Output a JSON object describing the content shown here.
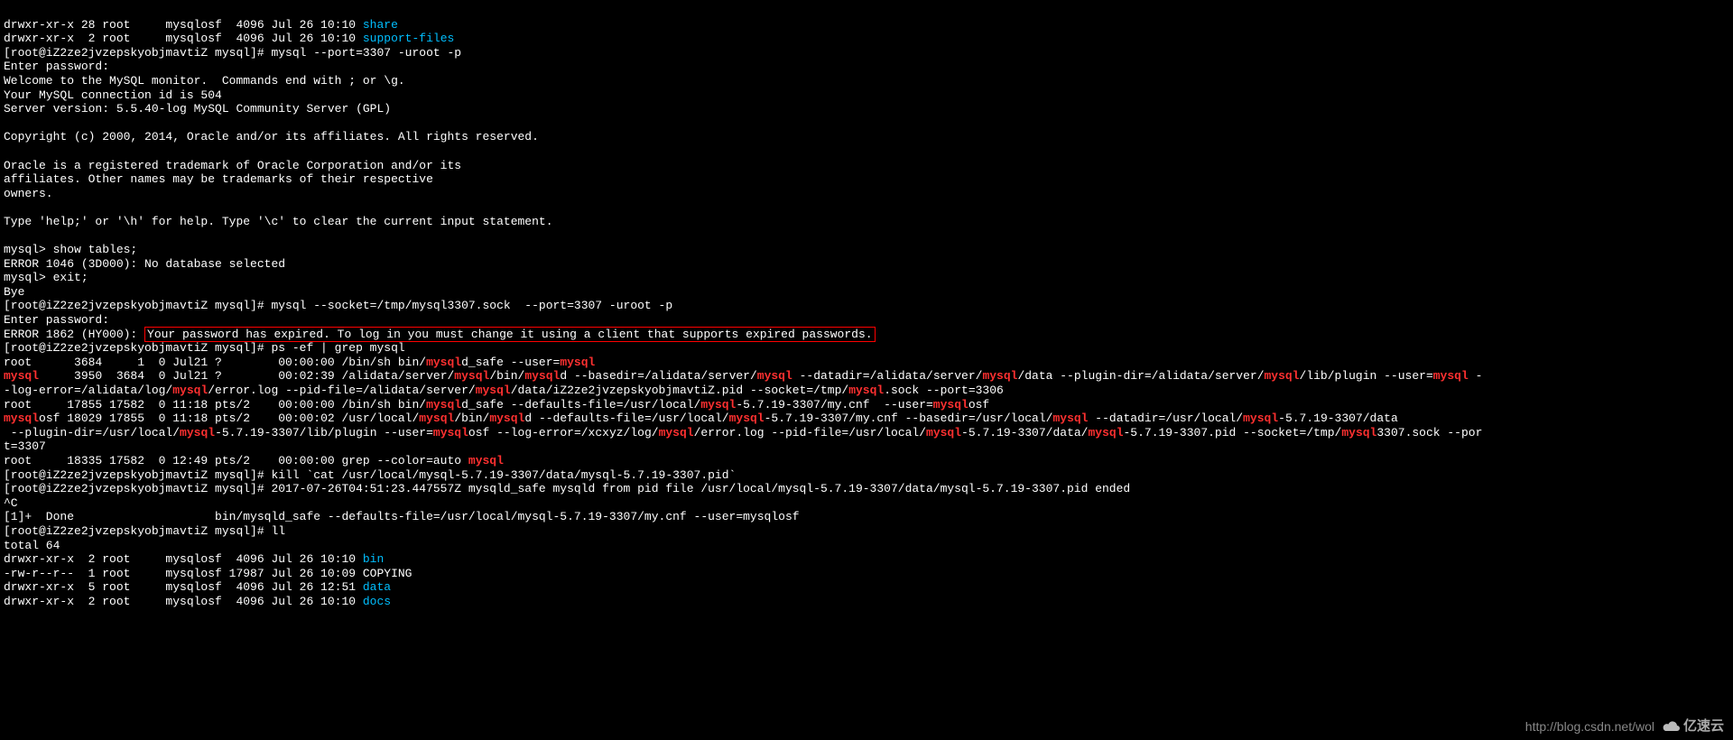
{
  "ls_top": {
    "l1a": "drwxr-xr-x 28 root     mysqlosf  4096 Jul 26 10:10 ",
    "l1b": "share",
    "l2a": "drwxr-xr-x  2 root     mysqlosf  4096 Jul 26 10:10 ",
    "l2b": "support-files"
  },
  "prompt1": "[root@iZ2ze2jvzepskyobjmavtiZ mysql]# mysql --port=3307 -uroot -p",
  "login": {
    "l1": "Enter password:",
    "l2": "Welcome to the MySQL monitor.  Commands end with ; or \\g.",
    "l3": "Your MySQL connection id is 504",
    "l4": "Server version: 5.5.40-log MySQL Community Server (GPL)",
    "blank1": "",
    "l5": "Copyright (c) 2000, 2014, Oracle and/or its affiliates. All rights reserved.",
    "blank2": "",
    "l6": "Oracle is a registered trademark of Oracle Corporation and/or its",
    "l7": "affiliates. Other names may be trademarks of their respective",
    "l8": "owners.",
    "blank3": "",
    "l9": "Type 'help;' or '\\h' for help. Type '\\c' to clear the current input statement.",
    "blank4": ""
  },
  "sql": {
    "l1": "mysql> show tables;",
    "l2": "ERROR 1046 (3D000): No database selected",
    "l3": "mysql> exit;",
    "l4": "Bye"
  },
  "prompt2": "[root@iZ2ze2jvzepskyobjmavtiZ mysql]# mysql --socket=/tmp/mysql3307.sock  --port=3307 -uroot -p",
  "enterpw": "Enter password:",
  "err": {
    "prefix": "ERROR 1862 (HY000): ",
    "msg": "Your password has expired. To log in you must change it using a client that supports expired passwords."
  },
  "prompt3": "[root@iZ2ze2jvzepskyobjmavtiZ mysql]# ps -ef | grep mysql",
  "ps": {
    "r1": {
      "a": "root      3684     1  0 Jul21 ?        00:00:00 /bin/sh bin/",
      "b": "mysql",
      "c": "d_safe --user=",
      "d": "mysql"
    },
    "r2": {
      "a": "mysql",
      "b": "     3950  3684  0 Jul21 ?        00:02:39 /alidata/server/",
      "c": "mysql",
      "d": "/bin/",
      "e": "mysql",
      "f": "d --basedir=/alidata/server/",
      "g": "mysql",
      "h": " --datadir=/alidata/server/",
      "i": "mysql",
      "j": "/data --plugin-dir=/alidata/server/",
      "k": "mysql",
      "l": "/lib/plugin --user=",
      "m": "mysql",
      "n": " -"
    },
    "r2b": {
      "a": "-log-error=/alidata/log/",
      "b": "mysql",
      "c": "/error.log --pid-file=/alidata/server/",
      "d": "mysql",
      "e": "/data/iZ2ze2jvzepskyobjmavtiZ.pid --socket=/tmp/",
      "f": "mysql",
      "g": ".sock --port=3306"
    },
    "r3": {
      "a": "root     17855 17582  0 11:18 pts/2    00:00:00 /bin/sh bin/",
      "b": "mysql",
      "c": "d_safe --defaults-file=/usr/local/",
      "d": "mysql",
      "e": "-5.7.19-3307/my.cnf  --user=",
      "f": "mysql",
      "g": "osf"
    },
    "r4": {
      "a": "mysql",
      "b": "osf 18029 17855  0 11:18 pts/2    00:00:02 /usr/local/",
      "c": "mysql",
      "d": "/bin/",
      "e": "mysql",
      "f": "d --defaults-file=/usr/local/",
      "g": "mysql",
      "h": "-5.7.19-3307/my.cnf --basedir=/usr/local/",
      "i": "mysql",
      "j": " --datadir=/usr/local/",
      "k": "mysql",
      "l": "-5.7.19-3307/data"
    },
    "r4b": {
      "a": " --plugin-dir=/usr/local/",
      "b": "mysql",
      "c": "-5.7.19-3307/lib/plugin --user=",
      "d": "mysql",
      "e": "osf --log-error=/xcxyz/log/",
      "f": "mysql",
      "g": "/error.log --pid-file=/usr/local/",
      "h": "mysql",
      "i": "-5.7.19-3307/data/",
      "j": "mysql",
      "k": "-5.7.19-3307.pid --socket=/tmp/",
      "l": "mysql",
      "m": "3307.sock --por"
    },
    "r4c": "t=3307",
    "r5": {
      "a": "root     18335 17582  0 12:49 pts/2    00:00:00 grep --color=auto ",
      "b": "mysql"
    }
  },
  "kill": {
    "l1": "[root@iZ2ze2jvzepskyobjmavtiZ mysql]# kill `cat /usr/local/mysql-5.7.19-3307/data/mysql-5.7.19-3307.pid`",
    "l2": "[root@iZ2ze2jvzepskyobjmavtiZ mysql]# 2017-07-26T04:51:23.447557Z mysqld_safe mysqld from pid file /usr/local/mysql-5.7.19-3307/data/mysql-5.7.19-3307.pid ended",
    "l3": "^C",
    "l4": "[1]+  Done                    bin/mysqld_safe --defaults-file=/usr/local/mysql-5.7.19-3307/my.cnf --user=mysqlosf"
  },
  "prompt4": "[root@iZ2ze2jvzepskyobjmavtiZ mysql]# ll",
  "ll": {
    "total": "total 64",
    "r1a": "drwxr-xr-x  2 root     mysqlosf  4096 Jul 26 10:10 ",
    "r1b": "bin",
    "r2": "-rw-r--r--  1 root     mysqlosf 17987 Jul 26 10:09 COPYING",
    "r3a": "drwxr-xr-x  5 root     mysqlosf  4096 Jul 26 12:51 ",
    "r3b": "data",
    "r4a": "drwxr-xr-x  2 root     mysqlosf  4096 Jul 26 10:10 ",
    "r4b": "docs"
  },
  "watermark": {
    "url": "http://blog.csdn.net/wol",
    "logo": "亿速云"
  }
}
